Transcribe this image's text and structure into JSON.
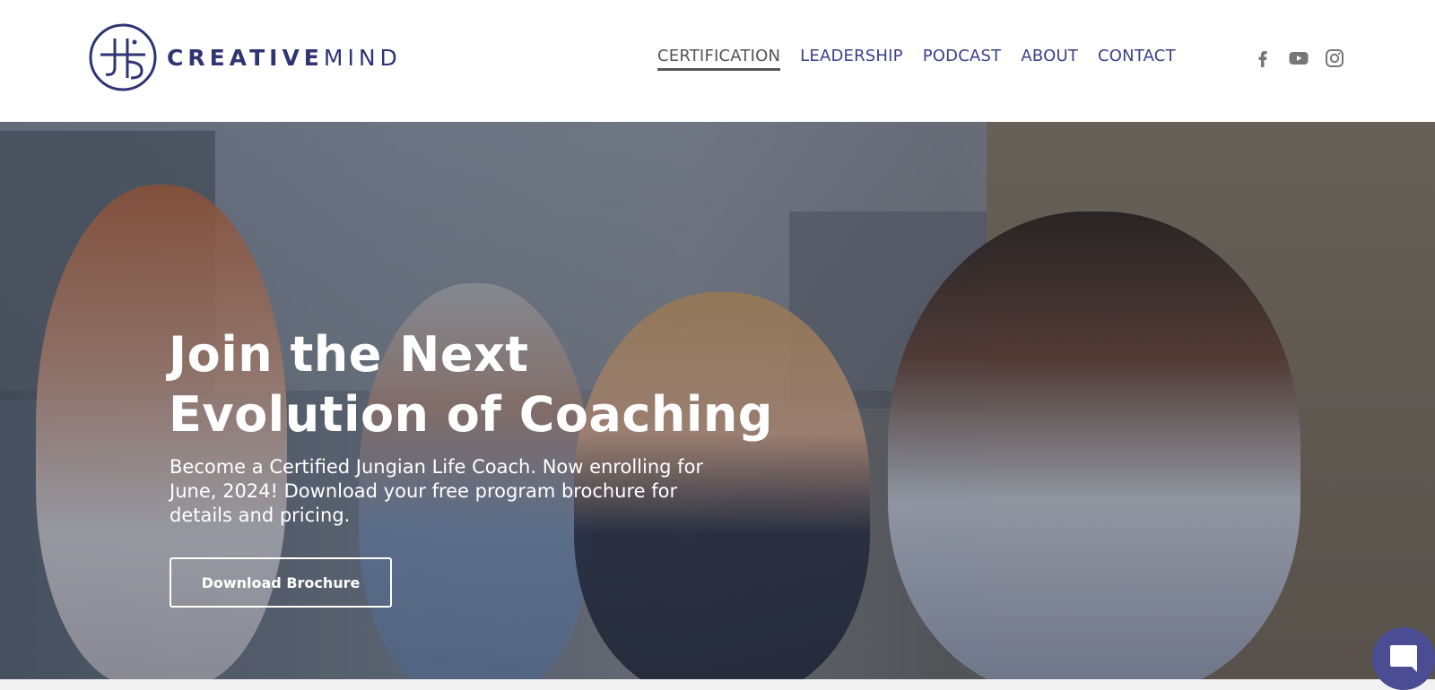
{
  "header": {
    "logo": {
      "word_bold": "CREATIVE",
      "word_light": "MIND",
      "brand_color": "#2f3473"
    },
    "nav": [
      {
        "label": "CERTIFICATION",
        "active": true
      },
      {
        "label": "LEADERSHIP",
        "active": false
      },
      {
        "label": "PODCAST",
        "active": false
      },
      {
        "label": "ABOUT",
        "active": false
      },
      {
        "label": "CONTACT",
        "active": false
      }
    ],
    "social_icons": [
      "facebook-icon",
      "youtube-icon",
      "instagram-icon"
    ]
  },
  "hero": {
    "title_line1": "Join the Next",
    "title_line2": "Evolution of Coaching",
    "subtitle": "Become a Certified Jungian Life Coach. Now enrolling for June, 2024! Download your free program brochure for details and pricing.",
    "button_label": "Download Brochure"
  },
  "chat": {
    "icon": "chat-icon",
    "color": "#4a4d94"
  },
  "colors": {
    "nav_text": "#3b3f8a",
    "nav_active": "#555555"
  }
}
